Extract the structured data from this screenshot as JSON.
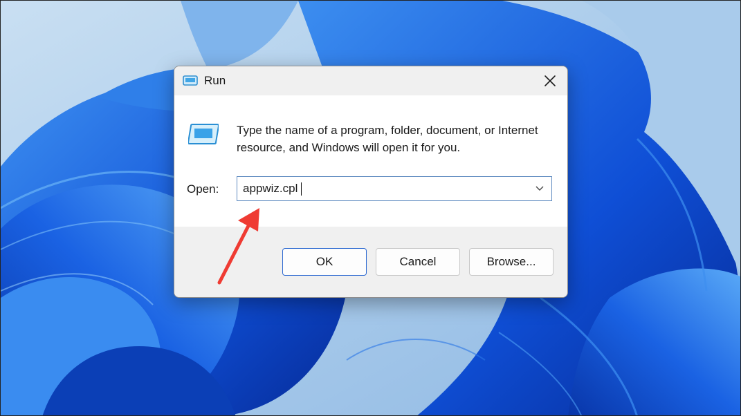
{
  "dialog": {
    "title": "Run",
    "description": "Type the name of a program, folder, document, or Internet resource, and Windows will open it for you.",
    "open_label": "Open:",
    "open_value": "appwiz.cpl",
    "buttons": {
      "ok": "OK",
      "cancel": "Cancel",
      "browse": "Browse..."
    }
  },
  "icons": {
    "title": "run-icon",
    "content": "run-icon",
    "close": "close-icon",
    "dropdown": "chevron-down-icon",
    "annotation": "red-arrow-annotation"
  },
  "colors": {
    "annotation_arrow": "#ef3b33",
    "input_border": "#5d8ac0",
    "ok_border": "#2f6bd1",
    "wallpaper_blue": "#1550d6"
  }
}
